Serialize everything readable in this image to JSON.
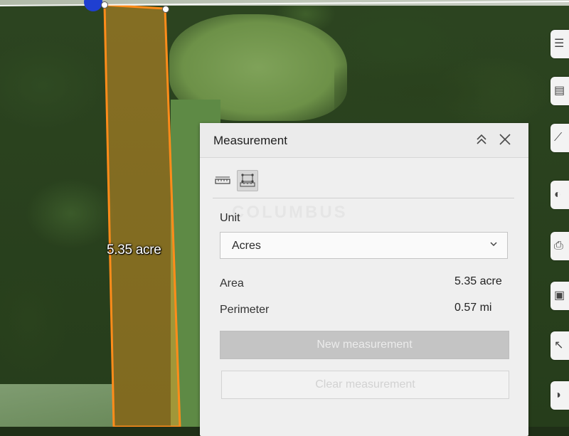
{
  "map": {
    "area_label": "5.35 acre"
  },
  "toolbar": {
    "items": [
      {
        "icon": "list-icon",
        "glyph": "☰"
      },
      {
        "icon": "legend-icon",
        "glyph": "▤"
      },
      {
        "icon": "ruler-icon",
        "glyph": "⟋"
      },
      {
        "icon": "palette-icon",
        "glyph": "◐"
      },
      {
        "icon": "print-icon",
        "glyph": "⎙"
      },
      {
        "icon": "bookmark-icon",
        "glyph": "▣"
      },
      {
        "icon": "select-cursor-icon",
        "glyph": "↖"
      },
      {
        "icon": "basemap-icon",
        "glyph": "◑"
      }
    ]
  },
  "measurement": {
    "title": "Measurement",
    "modes": [
      {
        "name": "distance-mode",
        "active": false
      },
      {
        "name": "area-mode",
        "active": true
      }
    ],
    "unit_label": "Unit",
    "unit_value": "Acres",
    "area_label": "Area",
    "area_value": "5.35 acre",
    "perimeter_label": "Perimeter",
    "perimeter_value": "0.57 mi",
    "new_button": "New measurement",
    "clear_button": "Clear measurement",
    "watermark": "COLUMBUS"
  },
  "colors": {
    "boundary": "#ff8c1a",
    "fill": "rgba(255,170,40,0.45)",
    "marker": "#1f3fd1"
  }
}
